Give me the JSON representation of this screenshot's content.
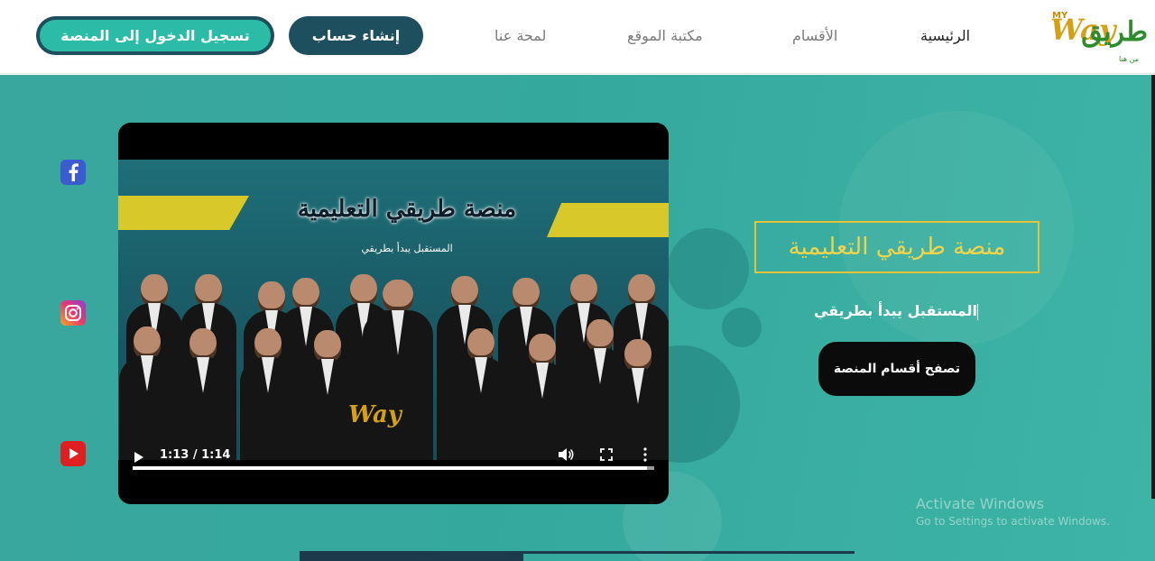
{
  "header": {
    "logo": {
      "brand_ar": "طريق",
      "brand_en": "Way",
      "my": "MY",
      "tagline": "من هنا"
    },
    "nav": [
      {
        "label": "الرئيسية",
        "active": true
      },
      {
        "label": "الأقسام",
        "active": false
      },
      {
        "label": "مكتبة الموقع",
        "active": false
      },
      {
        "label": "لمحة عنا",
        "active": false
      }
    ],
    "signup_label": "إنشاء حساب",
    "login_label": "تسجيل الدخول إلى المنصة"
  },
  "social": [
    {
      "icon": "facebook-icon"
    },
    {
      "icon": "instagram-icon"
    },
    {
      "icon": "youtube-icon"
    }
  ],
  "video": {
    "title": "منصة طريقي التعليمية",
    "subtitle": "المستقبل يبدأ بطريقي",
    "time": "1:13 / 1:14",
    "progress": 0.987,
    "logo_text": "Way"
  },
  "hero": {
    "brand": "منصة طريقي التعليمية",
    "slogan": "المستقبل يبدأ بطريقي",
    "cta_label": "تصفح أقسام المنصة"
  },
  "watermark": {
    "title": "Activate Windows",
    "subtitle": "Go to Settings to activate Windows."
  },
  "colors": {
    "primary_dark": "#1d4f5e",
    "teal": "#2cbba6",
    "gold": "#e2c33a",
    "hero_bg": "#3aa79f"
  }
}
